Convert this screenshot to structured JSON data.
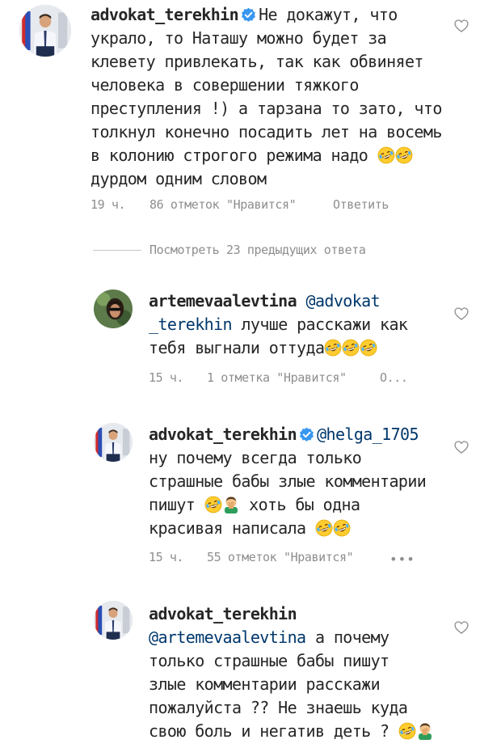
{
  "comments": [
    {
      "username": "advokat_terekhin",
      "verified": true,
      "text_lines": [
        "Не докажут, что",
        "украло, то Наташу можно будет за",
        "клевету привлекать, так как обвиняет",
        "человека в совершении тяжкого",
        "преступления !) а тарзана то зато, что",
        "толкнул конечно посадить лет на восемь",
        "в колонию строгого режима надо",
        "дурдом одним словом"
      ],
      "time": "19 ч.",
      "likes": "86 отметок \"Нравится\"",
      "reply": "Ответить"
    },
    {
      "username": "artemevaalevtina",
      "mention": "@advokat",
      "mention2": "_terekhin",
      "text_after_mention": "лучше расскажи как",
      "text_line3": "тебя выгнали оттуда",
      "time": "15 ч.",
      "likes": "1 отметка \"Нравится\"",
      "reply": "О..."
    },
    {
      "username": "advokat_terekhin",
      "mention": "@helga_1705",
      "text_lines": [
        "ну почему всегда только",
        "страшные бабы злые комментарии",
        "пишут",
        "хоть бы одна",
        "красивая написала"
      ],
      "time": "15 ч.",
      "likes": "55 отметок \"Нравится\"",
      "more": "•••"
    },
    {
      "username": "advokat_terekhin",
      "mention": "@artemevaalevtina",
      "text_lines": [
        "а почему",
        "только страшные бабы пишут",
        "злые комментарии расскажи",
        "пожалуйста ?? Не знаешь куда",
        "свою боль и негатив деть ?"
      ]
    }
  ],
  "view_replies": "Посмотреть 23 предыдущих ответа",
  "icons": [
    "verified-badge-icon",
    "heart-icon",
    "laughing-emoji-icon",
    "facepalm-emoji-icon"
  ],
  "colors": {
    "text": "#262626",
    "secondary": "#8e8e8e",
    "mention": "#00376b",
    "verified": "#3897f0"
  }
}
